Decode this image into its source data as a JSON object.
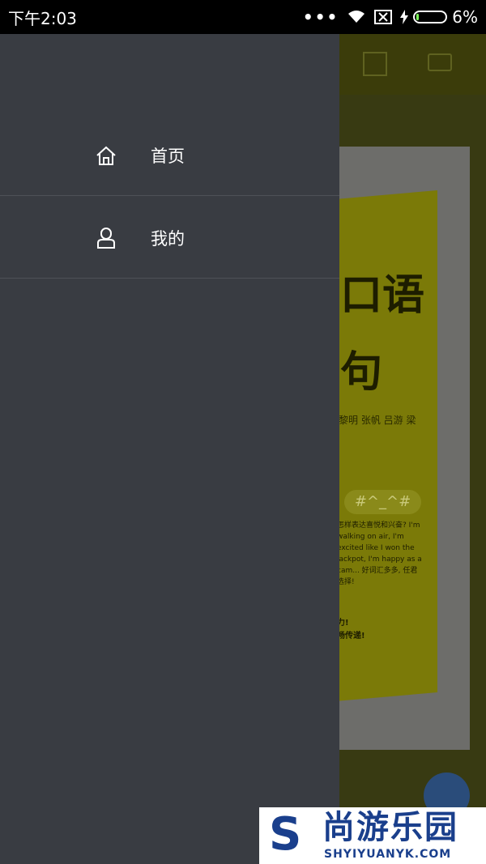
{
  "status_bar": {
    "time": "下午2:03",
    "dots": "•••",
    "battery_text": "6%",
    "battery_level": 0.06
  },
  "background": {
    "title_line1": "口语",
    "title_line2": "句",
    "authors": "黎明   张帆   吕游   梁",
    "bubble": "#^_^#",
    "body_text": "怎样表达喜悦和兴奋? I'm walking on air, I'm excited like I won the jackpot, I'm happy as a cam... 好词汇多多, 任君选择!",
    "bold_text_1": "力!",
    "bold_text_2": "畅传递!"
  },
  "drawer": {
    "items": [
      {
        "label": "首页",
        "icon": "home-icon"
      },
      {
        "label": "我的",
        "icon": "user-icon"
      }
    ]
  },
  "watermark": {
    "letter": "S",
    "title": "尚游乐园",
    "url": "SHYIYUANYK.COM"
  }
}
